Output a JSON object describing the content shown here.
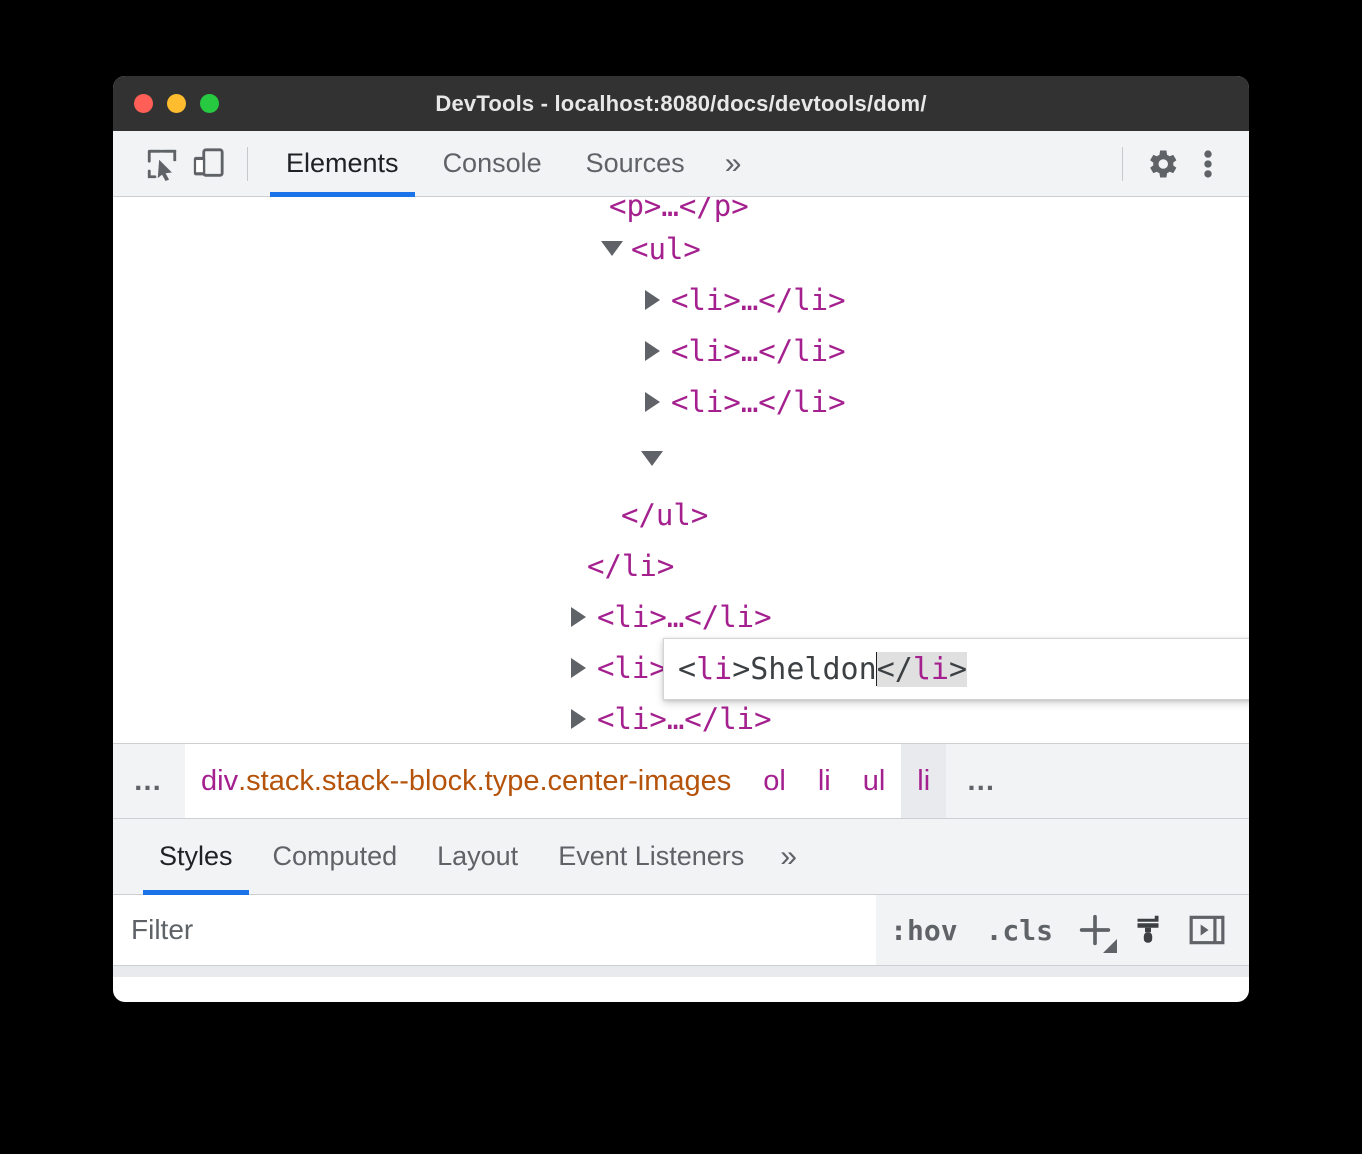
{
  "window": {
    "title": "DevTools - localhost:8080/docs/devtools/dom/",
    "traffic_lights": [
      {
        "name": "close",
        "color": "#ff5f56"
      },
      {
        "name": "minimize",
        "color": "#febc2e"
      },
      {
        "name": "maximize",
        "color": "#26c940"
      }
    ]
  },
  "toolbar": {
    "inspect_icon": "inspect-element-icon",
    "device_icon": "device-toolbar-icon",
    "tabs": [
      {
        "label": "Elements",
        "active": true
      },
      {
        "label": "Console",
        "active": false
      },
      {
        "label": "Sources",
        "active": false
      }
    ],
    "more_tabs": "»",
    "settings_icon": "gear-icon",
    "menu_icon": "kebab-menu-icon",
    "accent": "#1a73e8"
  },
  "dom_tree": {
    "clipped_top": "<p>…</p>",
    "rows": [
      {
        "indent": 1,
        "twisty": "open",
        "text": "<ul>"
      },
      {
        "indent": 2,
        "twisty": "closed",
        "text": "<li>…</li>"
      },
      {
        "indent": 2,
        "twisty": "closed",
        "text": "<li>…</li>"
      },
      {
        "indent": 2,
        "twisty": "closed",
        "text": "<li>…</li>"
      },
      {
        "indent": 2,
        "twisty": "open",
        "text": ""
      },
      {
        "indent": 1,
        "twisty": "none",
        "text": "</ul>"
      },
      {
        "indent": 0,
        "twisty": "none",
        "text": "</li>"
      },
      {
        "indent": 0,
        "twisty": "closed",
        "text": "<li>…</li>"
      },
      {
        "indent": 0,
        "twisty": "closed",
        "text": "<li>…</li>"
      },
      {
        "indent": 0,
        "twisty": "closed",
        "text": "<li>…</li>"
      }
    ],
    "tag_color": "#a4208e"
  },
  "edit_box": {
    "open_lt": "<",
    "open_tag": "li",
    "open_gt": ">",
    "content": "Sheldon",
    "close_lt": "</",
    "close_tag": "li",
    "close_gt": ">",
    "full_value": "<li>Sheldon</li>",
    "cursor_after": "Sheldon"
  },
  "breadcrumb": {
    "overflow_left": "…",
    "overflow_right": "…",
    "items": [
      {
        "tag": "div",
        "classes": ".stack.stack--block.type.center-images",
        "selected": false
      },
      {
        "tag": "ol",
        "classes": "",
        "selected": false
      },
      {
        "tag": "li",
        "classes": "",
        "selected": false
      },
      {
        "tag": "ul",
        "classes": "",
        "selected": false
      },
      {
        "tag": "li",
        "classes": "",
        "selected": true
      }
    ],
    "tag_color": "#a4208e",
    "class_color": "#b5530b"
  },
  "sidebar": {
    "tabs": [
      {
        "label": "Styles",
        "active": true
      },
      {
        "label": "Computed",
        "active": false
      },
      {
        "label": "Layout",
        "active": false
      },
      {
        "label": "Event Listeners",
        "active": false
      }
    ],
    "more_tabs": "»"
  },
  "filter_bar": {
    "placeholder": "Filter",
    "value": "",
    "hov_label": ":hov",
    "cls_label": ".cls",
    "new_rule_icon": "plus-icon",
    "color_picker_icon": "paint-brush-icon",
    "sidebar_toggle_icon": "sidebar-toggle-icon"
  }
}
